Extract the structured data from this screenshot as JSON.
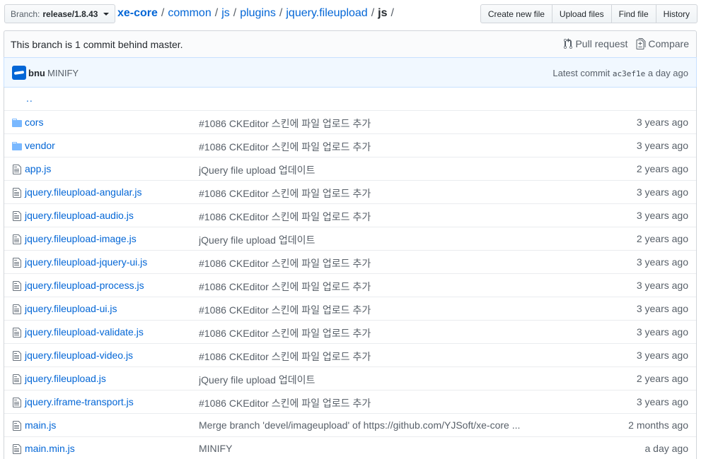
{
  "branch": {
    "label": "Branch:",
    "name": "release/1.8.43"
  },
  "breadcrumb": {
    "root": "xe-core",
    "parts": [
      "common",
      "js",
      "plugins",
      "jquery.fileupload"
    ],
    "current": "js",
    "sep": "/"
  },
  "toolbar": {
    "create_new_file": "Create new file",
    "upload_files": "Upload files",
    "find_file": "Find file",
    "history": "History"
  },
  "compare": {
    "status": "This branch is 1 commit behind master.",
    "pull_request": "Pull request",
    "compare": "Compare"
  },
  "commit": {
    "author": "bnu",
    "message": "MINIFY",
    "latest_label": "Latest commit",
    "sha": "ac3ef1e",
    "age": "a day ago"
  },
  "files": {
    "up": "..",
    "rows": [
      {
        "type": "dir",
        "name": "cors",
        "message": "#1086 CKEditor 스킨에 파일 업로드 추가",
        "age": "3 years ago"
      },
      {
        "type": "dir",
        "name": "vendor",
        "message": "#1086 CKEditor 스킨에 파일 업로드 추가",
        "age": "3 years ago"
      },
      {
        "type": "file",
        "name": "app.js",
        "message": "jQuery file upload 업데이트",
        "age": "2 years ago"
      },
      {
        "type": "file",
        "name": "jquery.fileupload-angular.js",
        "message": "#1086 CKEditor 스킨에 파일 업로드 추가",
        "age": "3 years ago"
      },
      {
        "type": "file",
        "name": "jquery.fileupload-audio.js",
        "message": "#1086 CKEditor 스킨에 파일 업로드 추가",
        "age": "3 years ago"
      },
      {
        "type": "file",
        "name": "jquery.fileupload-image.js",
        "message": "jQuery file upload 업데이트",
        "age": "2 years ago"
      },
      {
        "type": "file",
        "name": "jquery.fileupload-jquery-ui.js",
        "message": "#1086 CKEditor 스킨에 파일 업로드 추가",
        "age": "3 years ago"
      },
      {
        "type": "file",
        "name": "jquery.fileupload-process.js",
        "message": "#1086 CKEditor 스킨에 파일 업로드 추가",
        "age": "3 years ago"
      },
      {
        "type": "file",
        "name": "jquery.fileupload-ui.js",
        "message": "#1086 CKEditor 스킨에 파일 업로드 추가",
        "age": "3 years ago"
      },
      {
        "type": "file",
        "name": "jquery.fileupload-validate.js",
        "message": "#1086 CKEditor 스킨에 파일 업로드 추가",
        "age": "3 years ago"
      },
      {
        "type": "file",
        "name": "jquery.fileupload-video.js",
        "message": "#1086 CKEditor 스킨에 파일 업로드 추가",
        "age": "3 years ago"
      },
      {
        "type": "file",
        "name": "jquery.fileupload.js",
        "message": "jQuery file upload 업데이트",
        "age": "2 years ago"
      },
      {
        "type": "file",
        "name": "jquery.iframe-transport.js",
        "message": "#1086 CKEditor 스킨에 파일 업로드 추가",
        "age": "3 years ago"
      },
      {
        "type": "file",
        "name": "main.js",
        "message": "Merge branch 'devel/imageupload' of https://github.com/YJSoft/xe-core ...",
        "age": "2 months ago"
      },
      {
        "type": "file",
        "name": "main.min.js",
        "message": "MINIFY",
        "age": "a day ago"
      }
    ]
  },
  "colors": {
    "link": "#0366d6",
    "muted": "#586069",
    "folder": "#79b8ff",
    "commit_bg": "#f1f8ff"
  }
}
